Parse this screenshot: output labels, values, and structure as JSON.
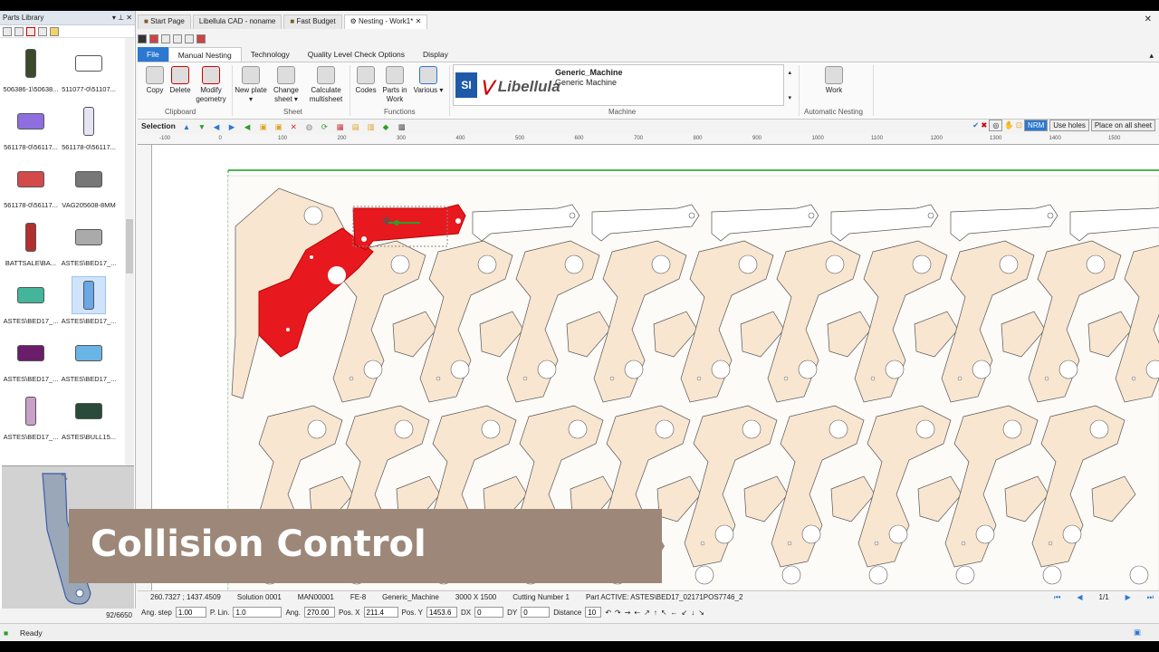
{
  "library": {
    "title": "Parts Library",
    "count": "92/6650",
    "items": [
      {
        "label": "506386-1\\50638...",
        "color": "#3a4a2a"
      },
      {
        "label": "511077-0\\51107...",
        "color": "#ffffff"
      },
      {
        "label": "561178-0\\56117...",
        "color": "#8f6ee0"
      },
      {
        "label": "561178-0\\56117...",
        "color": "#e4e4f4"
      },
      {
        "label": "561178-0\\56117...",
        "color": "#d24a4a"
      },
      {
        "label": "VAG205608-8MM",
        "color": "#777777"
      },
      {
        "label": "BATTSALE\\BA...",
        "color": "#b23030"
      },
      {
        "label": "ASTES\\BED17_...",
        "color": "#aaaaaa"
      },
      {
        "label": "ASTES\\BED17_...",
        "color": "#43b59a"
      },
      {
        "label": "ASTES\\BED17_...",
        "color": "#6aa7e6"
      },
      {
        "label": "ASTES\\BED17_...",
        "color": "#6a1d6a"
      },
      {
        "label": "ASTES\\BED17_...",
        "color": "#6ab4e6"
      },
      {
        "label": "ASTES\\BED17_...",
        "color": "#c8a0c8"
      },
      {
        "label": "ASTES\\BULL15...",
        "color": "#2a4a3a"
      }
    ]
  },
  "doc_tabs": [
    "Start Page",
    "Libellula CAD - noname",
    "Fast Budget",
    "Nesting - Work1*"
  ],
  "ribbon_tabs": [
    "File",
    "Manual Nesting",
    "Technology",
    "Quality Level Check Options",
    "Display"
  ],
  "ribbon": {
    "buttons": [
      {
        "label": "Copy"
      },
      {
        "label": "Delete"
      },
      {
        "label": "Modify geometry"
      },
      {
        "label": "New plate ▾"
      },
      {
        "label": "Change sheet ▾"
      },
      {
        "label": "Calculate multisheet"
      },
      {
        "label": "Codes"
      },
      {
        "label": "Parts in Work"
      },
      {
        "label": "Various ▾"
      },
      {
        "label": "Work"
      }
    ],
    "groups": [
      "Clipboard",
      "Sheet",
      "Functions",
      "Machine",
      "Automatic Nesting"
    ],
    "machine_name": "Generic_Machine",
    "machine_desc": "Generic Machine",
    "brand": "Libellula",
    "logo_text": "SI"
  },
  "selection_bar": {
    "label": "Selection",
    "options": [
      "NRM",
      "Use holes",
      "Place on all sheet"
    ]
  },
  "ruler_ticks": [
    "-100",
    "0",
    "100",
    "200",
    "300",
    "400",
    "500",
    "600",
    "700",
    "800",
    "900",
    "1000",
    "1100",
    "1200",
    "1300",
    "1400",
    "1500"
  ],
  "overlay_title": "Collision Control",
  "status": {
    "coords": "260.7327 ; 1437.4509",
    "solution": "Solution 0001",
    "man": "MAN00001",
    "material": "FE-8",
    "machine": "Generic_Machine",
    "sheet": "3000 X 1500",
    "cutting": "Cutting Number 1",
    "part_active": "Part ACTIVE: ASTES\\BED17_02171POS7746_2",
    "page": "1/1"
  },
  "inputs": {
    "ang_step_label": "Ang. step",
    "ang_step": "1.00",
    "plin_label": "P. Lin.",
    "plin": "1.0",
    "ang_label": "Ang.",
    "ang": "270.00",
    "posx_label": "Pos. X",
    "posx": "211.4",
    "posy_label": "Pos. Y",
    "posy": "1453.6",
    "dx_label": "DX",
    "dx": "0",
    "dy_label": "DY",
    "dy": "0",
    "dist_label": "Distance",
    "dist": "10"
  },
  "bottom_status": "Ready",
  "colors": {
    "part_fill": "#f8e6d0",
    "part_stroke": "#555555",
    "active": "#e8191e",
    "accent": "#2b78d0"
  }
}
